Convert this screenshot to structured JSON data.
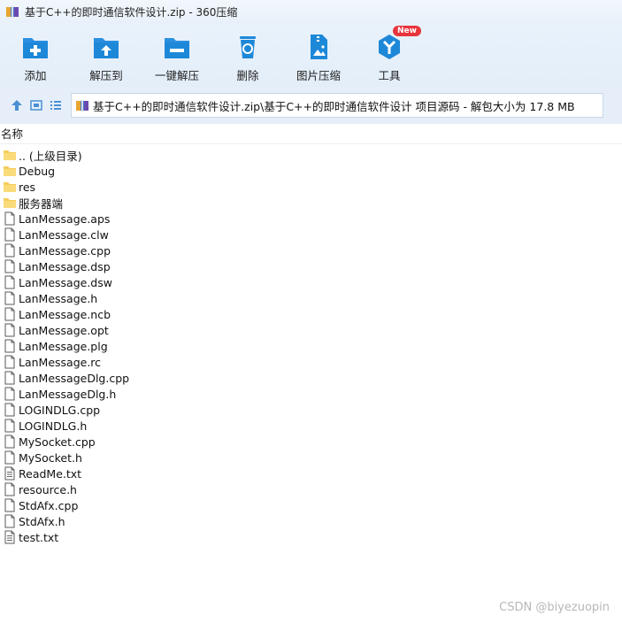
{
  "window": {
    "title": "基于C++的即时通信软件设计.zip - 360压缩"
  },
  "toolbar": {
    "buttons": [
      {
        "label": "添加",
        "icon": "add-icon"
      },
      {
        "label": "解压到",
        "icon": "extract-to-icon"
      },
      {
        "label": "一键解压",
        "icon": "quick-extract-icon"
      },
      {
        "label": "删除",
        "icon": "delete-icon"
      },
      {
        "label": "图片压缩",
        "icon": "image-compress-icon"
      },
      {
        "label": "工具",
        "icon": "tools-icon",
        "badge": "New"
      }
    ]
  },
  "address": {
    "path": "基于C++的即时通信软件设计.zip\\基于C++的即时通信软件设计 项目源码 - 解包大小为 17.8 MB"
  },
  "columns": {
    "name": "名称"
  },
  "files": [
    {
      "name": ".. (上级目录)",
      "type": "folder"
    },
    {
      "name": "Debug",
      "type": "folder"
    },
    {
      "name": "res",
      "type": "folder"
    },
    {
      "name": "服务器端",
      "type": "folder"
    },
    {
      "name": "LanMessage.aps",
      "type": "file"
    },
    {
      "name": "LanMessage.clw",
      "type": "file"
    },
    {
      "name": "LanMessage.cpp",
      "type": "file"
    },
    {
      "name": "LanMessage.dsp",
      "type": "file"
    },
    {
      "name": "LanMessage.dsw",
      "type": "file"
    },
    {
      "name": "LanMessage.h",
      "type": "file"
    },
    {
      "name": "LanMessage.ncb",
      "type": "file"
    },
    {
      "name": "LanMessage.opt",
      "type": "file"
    },
    {
      "name": "LanMessage.plg",
      "type": "file"
    },
    {
      "name": "LanMessage.rc",
      "type": "file"
    },
    {
      "name": "LanMessageDlg.cpp",
      "type": "file"
    },
    {
      "name": "LanMessageDlg.h",
      "type": "file"
    },
    {
      "name": "LOGINDLG.cpp",
      "type": "file"
    },
    {
      "name": "LOGINDLG.h",
      "type": "file"
    },
    {
      "name": "MySocket.cpp",
      "type": "file"
    },
    {
      "name": "MySocket.h",
      "type": "file"
    },
    {
      "name": "ReadMe.txt",
      "type": "text"
    },
    {
      "name": "resource.h",
      "type": "file"
    },
    {
      "name": "StdAfx.cpp",
      "type": "file"
    },
    {
      "name": "StdAfx.h",
      "type": "file"
    },
    {
      "name": "test.txt",
      "type": "text"
    }
  ],
  "watermark": "CSDN @biyezuopin",
  "colors": {
    "accent": "#1e88d8",
    "folder": "#f5cd5a",
    "badge": "#e8353c"
  }
}
